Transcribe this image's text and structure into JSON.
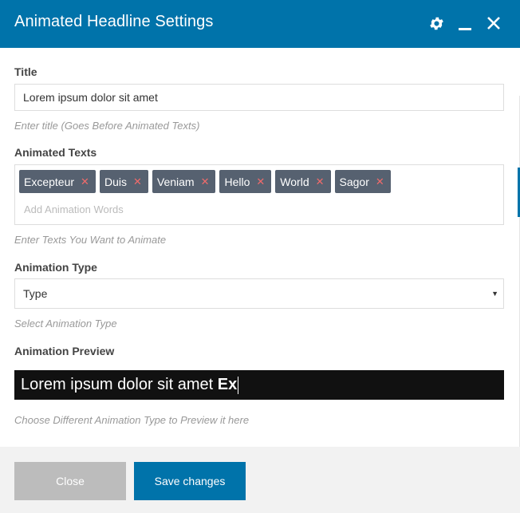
{
  "header": {
    "title": "Animated Headline Settings",
    "icons": [
      "gear-icon",
      "minimize-icon",
      "close-icon"
    ]
  },
  "fields": {
    "title": {
      "label": "Title",
      "value": "Lorem ipsum dolor sit amet",
      "help": "Enter title (Goes Before Animated Texts)"
    },
    "animated_texts": {
      "label": "Animated Texts",
      "tags": [
        "Excepteur",
        "Duis",
        "Veniam",
        "Hello",
        "World",
        "Sagor"
      ],
      "remove_glyph": "✕",
      "placeholder": "Add Animation Words",
      "help": "Enter Texts You Want to Animate"
    },
    "animation_type": {
      "label": "Animation Type",
      "selected": "Type",
      "help": "Select Animation Type"
    },
    "animation_preview": {
      "label": "Animation Preview",
      "static_text": "Lorem ipsum dolor sit amet",
      "animated_text": "Ex",
      "help": "Choose Different Animation Type to Preview it here"
    }
  },
  "footer": {
    "close_label": "Close",
    "save_label": "Save changes"
  },
  "colors": {
    "header_bg": "#0073aa",
    "tag_bg": "#566170",
    "tag_remove": "#f06b6b",
    "save_button": "#0073aa",
    "close_button": "#bcbcbc",
    "preview_bg": "#111111"
  }
}
